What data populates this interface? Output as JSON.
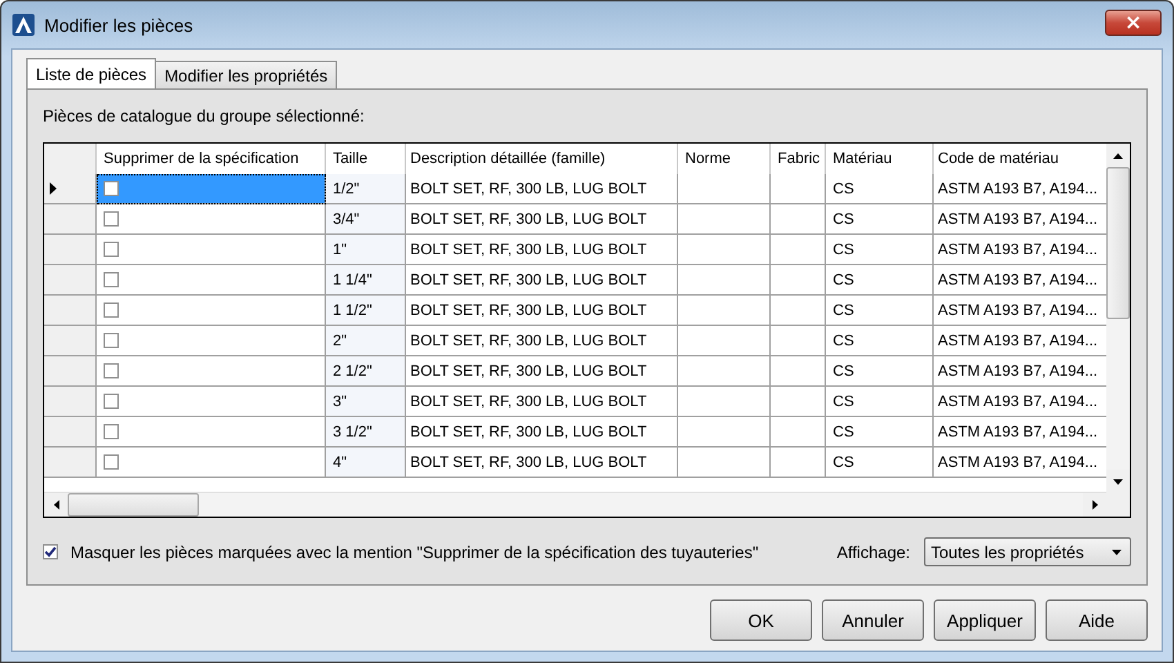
{
  "window": {
    "title": "Modifier les pièces",
    "close_label": "×"
  },
  "tabs": [
    {
      "label": "Liste de pièces",
      "selected": true
    },
    {
      "label": "Modifier les propriétés",
      "selected": false
    }
  ],
  "section_label": "Pièces de catalogue du groupe sélectionné:",
  "table": {
    "columns": [
      "Supprimer de la spécification",
      "Taille",
      "Description détaillée (famille)",
      "Norme",
      "Fabric",
      "Matériau",
      "Code de matériau"
    ],
    "rows": [
      {
        "selected": true,
        "checked": false,
        "size": "1/2\"",
        "description": "BOLT SET, RF, 300 LB, LUG BOLT",
        "material": "CS",
        "code": "ASTM A193 B7, A194..."
      },
      {
        "selected": false,
        "checked": false,
        "size": "3/4\"",
        "description": "BOLT SET, RF, 300 LB, LUG BOLT",
        "material": "CS",
        "code": "ASTM A193 B7, A194..."
      },
      {
        "selected": false,
        "checked": false,
        "size": "1\"",
        "description": "BOLT SET, RF, 300 LB, LUG BOLT",
        "material": "CS",
        "code": "ASTM A193 B7, A194..."
      },
      {
        "selected": false,
        "checked": false,
        "size": "1 1/4\"",
        "description": "BOLT SET, RF, 300 LB, LUG BOLT",
        "material": "CS",
        "code": "ASTM A193 B7, A194..."
      },
      {
        "selected": false,
        "checked": false,
        "size": "1 1/2\"",
        "description": "BOLT SET, RF, 300 LB, LUG BOLT",
        "material": "CS",
        "code": "ASTM A193 B7, A194..."
      },
      {
        "selected": false,
        "checked": false,
        "size": "2\"",
        "description": "BOLT SET, RF, 300 LB, LUG BOLT",
        "material": "CS",
        "code": "ASTM A193 B7, A194..."
      },
      {
        "selected": false,
        "checked": false,
        "size": "2 1/2\"",
        "description": "BOLT SET, RF, 300 LB, LUG BOLT",
        "material": "CS",
        "code": "ASTM A193 B7, A194..."
      },
      {
        "selected": false,
        "checked": false,
        "size": "3\"",
        "description": "BOLT SET, RF, 300 LB, LUG BOLT",
        "material": "CS",
        "code": "ASTM A193 B7, A194..."
      },
      {
        "selected": false,
        "checked": false,
        "size": "3 1/2\"",
        "description": "BOLT SET, RF, 300 LB, LUG BOLT",
        "material": "CS",
        "code": "ASTM A193 B7, A194..."
      },
      {
        "selected": false,
        "checked": false,
        "size": "4\"",
        "description": "BOLT SET, RF, 300 LB, LUG BOLT",
        "material": "CS",
        "code": "ASTM A193 B7, A194..."
      }
    ]
  },
  "hide_option": {
    "label": "Masquer les pièces marquées avec la mention \"Supprimer de la spécification des tuyauteries\"",
    "checked": true
  },
  "display": {
    "label": "Affichage:",
    "value": "Toutes les propriétés"
  },
  "buttons": [
    "OK",
    "Annuler",
    "Appliquer",
    "Aide"
  ]
}
